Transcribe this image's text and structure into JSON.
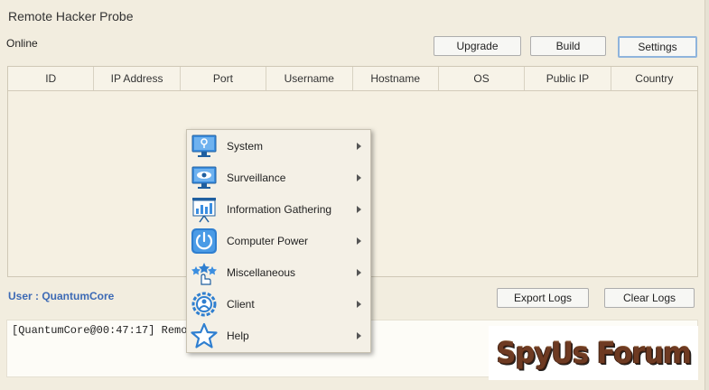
{
  "app": {
    "title": "Remote Hacker Probe"
  },
  "status": "Online",
  "toolbar": {
    "upgrade": "Upgrade",
    "build": "Build",
    "settings": "Settings"
  },
  "table": {
    "columns": [
      "ID",
      "IP Address",
      "Port",
      "Username",
      "Hostname",
      "OS",
      "Public IP",
      "Country"
    ],
    "rows": []
  },
  "context_menu": {
    "items": [
      {
        "label": "System",
        "icon": "monitor-key-icon"
      },
      {
        "label": "Surveillance",
        "icon": "monitor-eye-icon"
      },
      {
        "label": "Information Gathering",
        "icon": "presentation-chart-icon"
      },
      {
        "label": "Computer Power",
        "icon": "power-icon"
      },
      {
        "label": "Miscellaneous",
        "icon": "stars-hand-icon"
      },
      {
        "label": "Client",
        "icon": "client-gear-icon"
      },
      {
        "label": "Help",
        "icon": "star-icon"
      }
    ]
  },
  "user": {
    "label": "User : QuantumCore"
  },
  "logs": {
    "export": "Export Logs",
    "clear": "Clear Logs",
    "text": "[QuantumCore@00:47:17] Remot"
  },
  "watermark": "SpyUs Forum",
  "colors": {
    "accent": "#3d6ab5",
    "icon_blue": "#2f7fd0",
    "background": "#f2eddf"
  }
}
